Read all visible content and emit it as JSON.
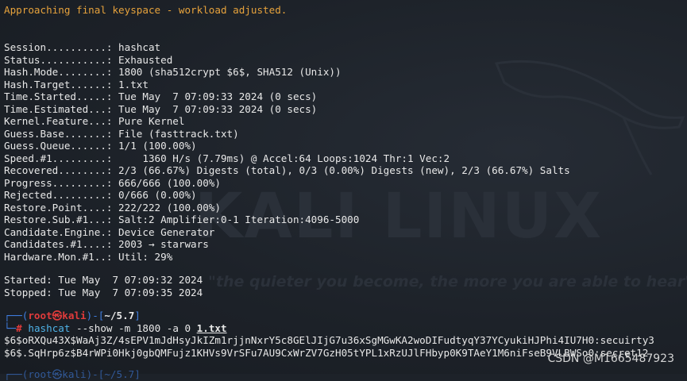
{
  "terminal": {
    "warning": "Approaching final keyspace - workload adjusted.",
    "status_lines": [
      "Session..........: hashcat",
      "Status...........: Exhausted",
      "Hash.Mode........: 1800 (sha512crypt $6$, SHA512 (Unix))",
      "Hash.Target......: 1.txt",
      "Time.Started.....: Tue May  7 07:09:33 2024 (0 secs)",
      "Time.Estimated...: Tue May  7 07:09:33 2024 (0 secs)",
      "Kernel.Feature...: Pure Kernel",
      "Guess.Base.......: File (fasttrack.txt)",
      "Guess.Queue......: 1/1 (100.00%)",
      "Speed.#1.........:     1360 H/s (7.79ms) @ Accel:64 Loops:1024 Thr:1 Vec:2",
      "Recovered........: 2/3 (66.67%) Digests (total), 0/3 (0.00%) Digests (new), 2/3 (66.67%) Salts",
      "Progress.........: 666/666 (100.00%)",
      "Rejected.........: 0/666 (0.00%)",
      "Restore.Point....: 222/222 (100.00%)",
      "Restore.Sub.#1...: Salt:2 Amplifier:0-1 Iteration:4096-5000",
      "Candidate.Engine.: Device Generator",
      "Candidates.#1....: 2003 → starwars",
      "Hardware.Mon.#1..: Util: 29%"
    ],
    "started": "Started: Tue May  7 07:09:32 2024",
    "stopped": "Stopped: Tue May  7 07:09:35 2024",
    "prompt": {
      "corner_top": "┌──(",
      "user": "root㉿kali",
      "mid": ")-[",
      "path": "~/5.7",
      "close": "]",
      "corner_bottom": "└─",
      "symbol": "#"
    },
    "command": {
      "program": "hashcat",
      "args": " --show -m 1800 -a 0 ",
      "file": "1.txt"
    },
    "results": [
      "$6$oRXQu43X$WaAj3Z/4sEPV1mJdHsyJkIZm1rjjnNxrY5c8GElJIjG7u36xSgMGwKA2woDIFudtyqY37YCyukiHJPhi4IU7H0:secuirty3",
      "$6$.SqHrp6z$B4rWPi0Hkj0gbQMFujz1KHVs9VrSFu7AU9CxWrZV7GzH05tYPL1xRzUJlFHbyp0K9TAeY1M6niFseB9VLBWSo0:secret12"
    ],
    "next_prompt_partial": "┌──(root㉿kali)-[~/5.7]"
  },
  "background": {
    "logo_text": "KALI LINUX",
    "quote": "\"the quieter you become, the more you are able to hear\""
  },
  "watermark": "CSDN @M1665487923",
  "colors": {
    "background": "#1d2229",
    "warning": "#e6a23c",
    "prompt_bracket": "#3f7de0",
    "prompt_user": "#e03b3b",
    "command": "#4fb3e8"
  }
}
